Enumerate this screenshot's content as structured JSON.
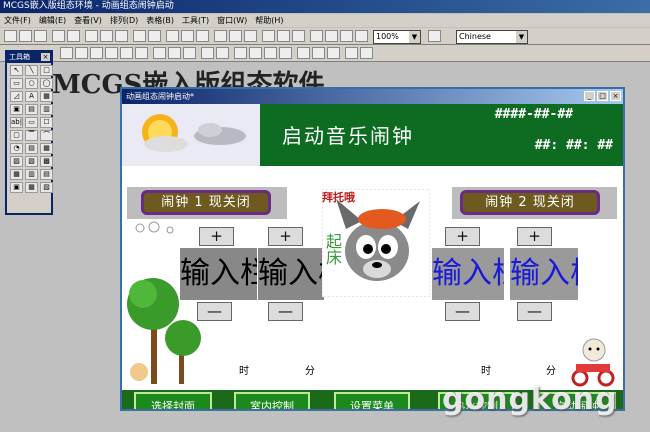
{
  "app": {
    "title": "MCGS嵌入版组态环境 - 动画组态闹钟启动"
  },
  "menu": [
    "文件(F)",
    "编辑(E)",
    "查看(V)",
    "排列(D)",
    "表格(B)",
    "工具(T)",
    "窗口(W)",
    "帮助(H)"
  ],
  "toolbar": {
    "zoom": "100%",
    "language": "Chinese"
  },
  "background_title": "MCGS嵌入版组态软件",
  "toolbox": {
    "title": "工具箱",
    "close": "×",
    "tools": [
      "↖",
      "╲",
      "□",
      "▭",
      "○",
      "◯",
      "◿",
      "A",
      "▦",
      "▣",
      "▤",
      "▥",
      "ab|",
      "▭",
      "☐",
      "▢",
      "▔",
      "⌒",
      "◔",
      "▤",
      "▦",
      "▨",
      "▧",
      "▩",
      "▦",
      "▥",
      "▤",
      "▣",
      "▦",
      "▧"
    ]
  },
  "child_window": {
    "title": "动画组态闹钟启动*",
    "header": {
      "title": "启动音乐闹钟",
      "date": "####-##-##",
      "time": "##: ##: ##"
    },
    "alarm1": {
      "label": "闹钟 1 现关闭"
    },
    "alarm2": {
      "label": "闹钟 2 现关闭"
    },
    "plus": "+",
    "minus": "—",
    "input_label": "输入栏",
    "hour": "时",
    "minute": "分",
    "wolf_text": "拜托哦",
    "wolf_side_text": "起床",
    "buttons": [
      "选择封面",
      "室内控制",
      "设置菜单",
      "热水控制",
      "启动闹钟"
    ]
  },
  "watermark": "gongkong",
  "colors": {
    "header_green": "#0e6b22",
    "button_green": "#1b8a1b",
    "pill_brown": "#6e5a1e",
    "pill_border": "#6a2a8a",
    "blue_text": "#1a1ad8"
  }
}
